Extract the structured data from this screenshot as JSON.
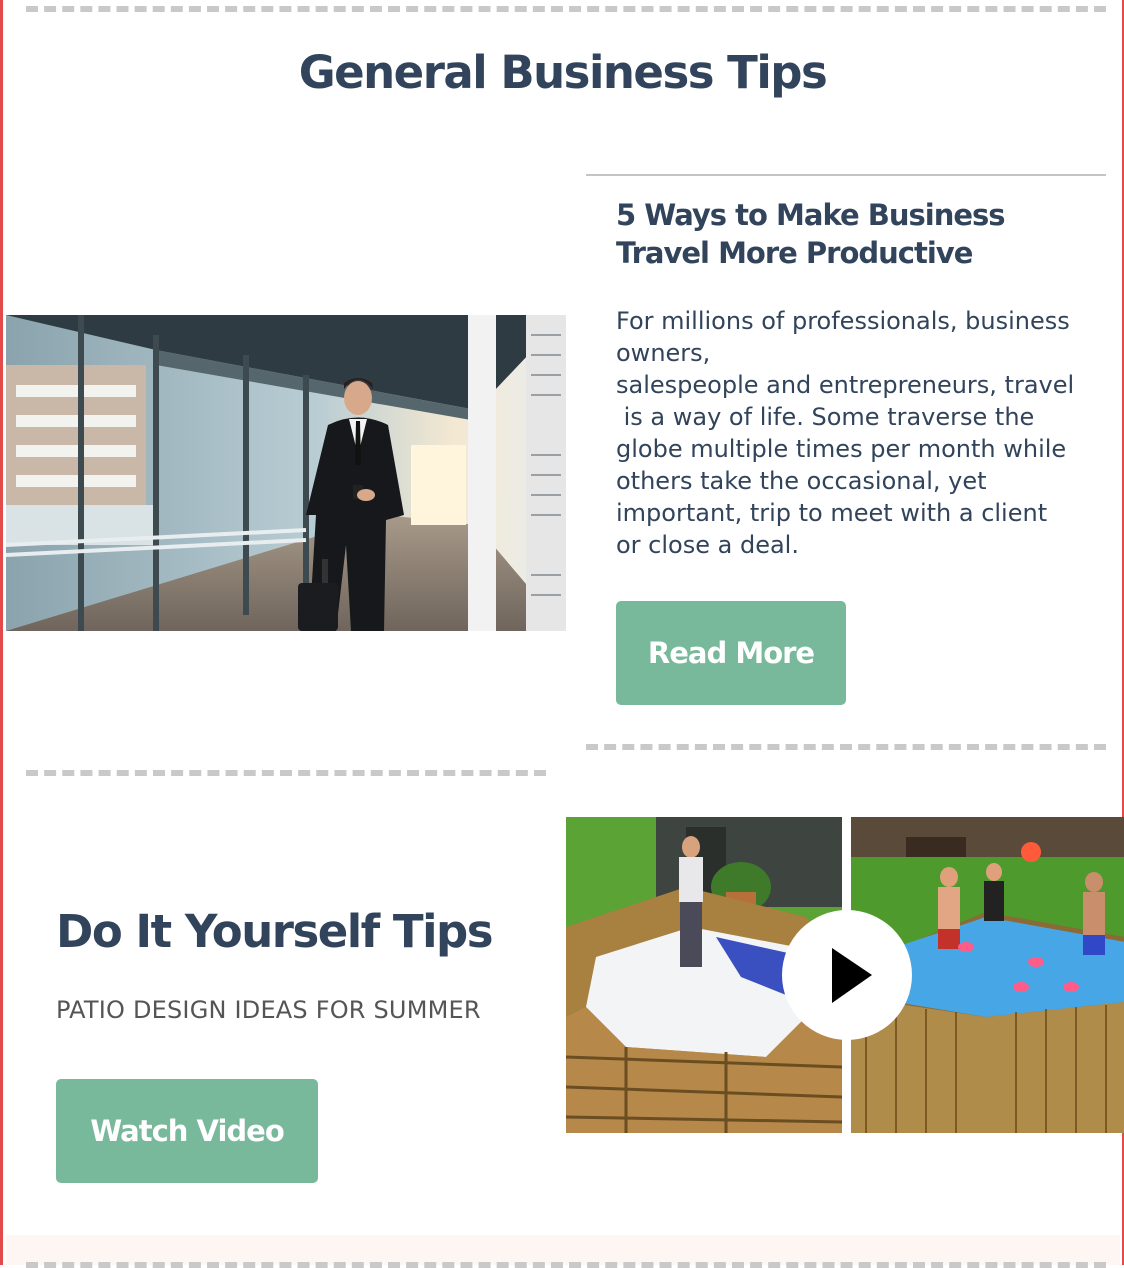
{
  "section": {
    "title": "General Business Tips"
  },
  "article": {
    "title": "5 Ways to Make Business Travel More Productive",
    "body_lines": [
      "For millions of professionals, business",
      "owners,",
      "salespeople and entrepreneurs, travel",
      " is a way of life. Some traverse the",
      "globe multiple times per month while",
      "others take the occasional, yet",
      "important, trip to meet with a client",
      "or close a deal."
    ],
    "button_label": "Read More",
    "image_icon": "businessman-travel-photo"
  },
  "diy": {
    "title": "Do It Yourself Tips",
    "subtitle": "PATIO DESIGN IDEAS FOR SUMMER",
    "button_label": "Watch Video",
    "video_icon": "play-icon"
  },
  "colors": {
    "heading": "#32445b",
    "button": "#78b89b",
    "frame_border": "#e34b4b",
    "dash": "#c9c9c9"
  }
}
